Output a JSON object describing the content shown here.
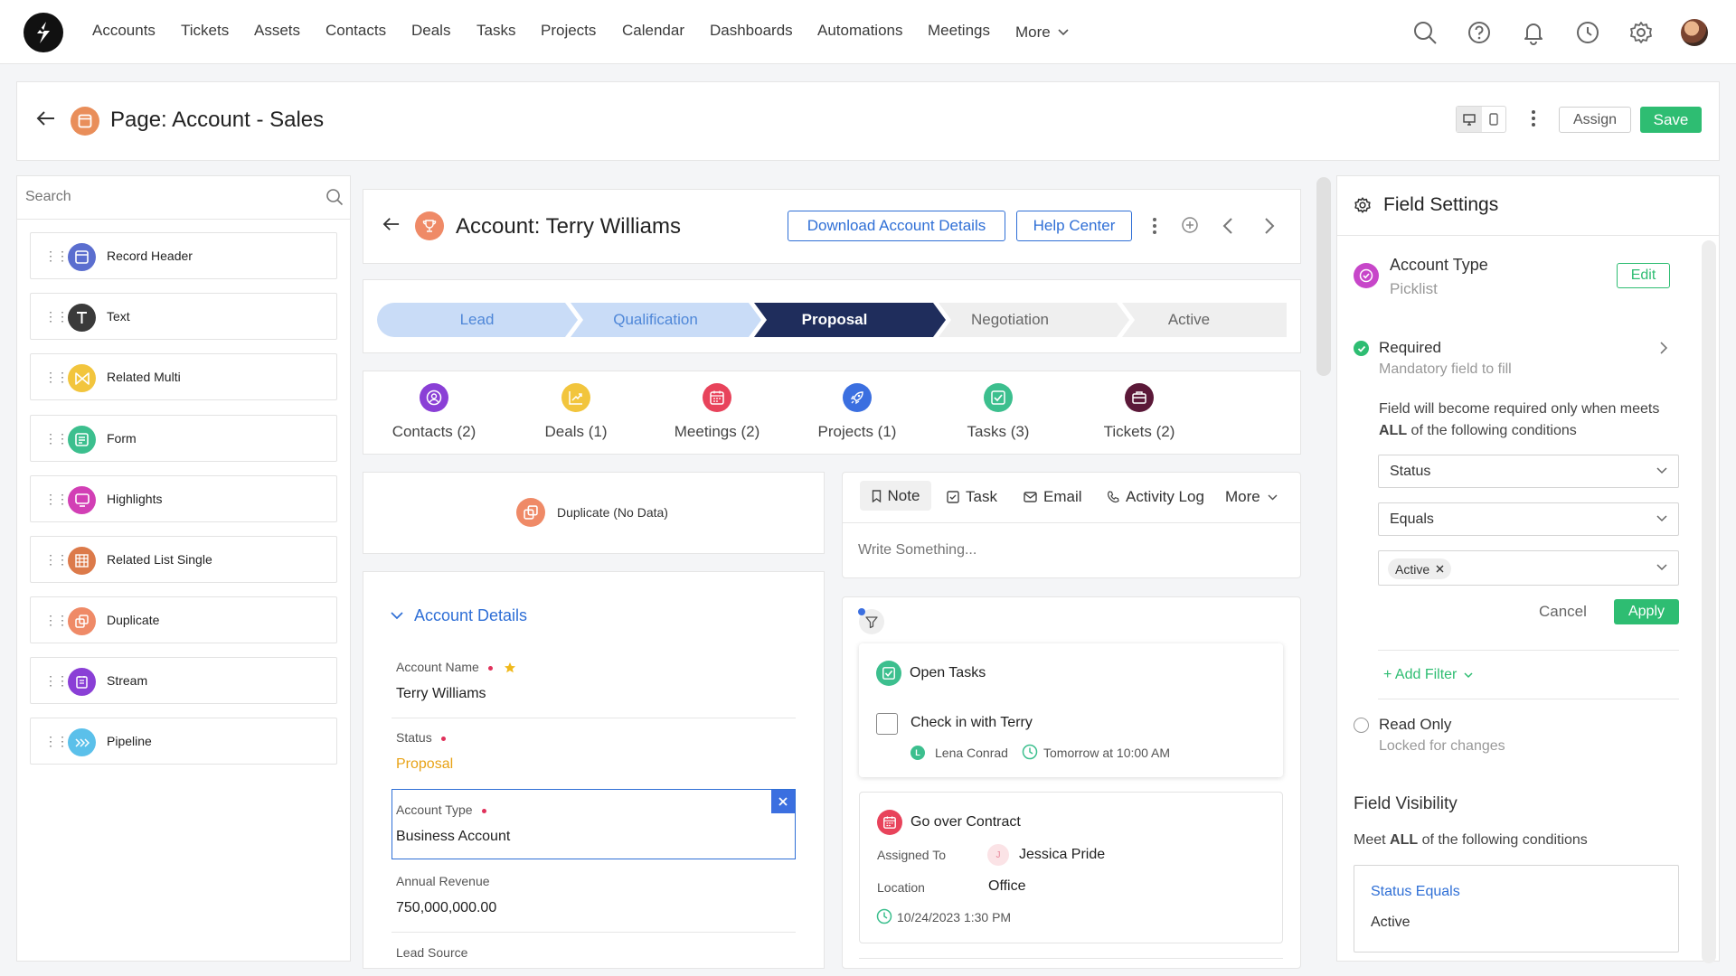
{
  "nav": {
    "items": [
      "Accounts",
      "Tickets",
      "Assets",
      "Contacts",
      "Deals",
      "Tasks",
      "Projects",
      "Calendar",
      "Dashboards",
      "Automations",
      "Meetings"
    ],
    "more_label": "More"
  },
  "header": {
    "title": "Page: Account - Sales",
    "assign_label": "Assign",
    "save_label": "Save"
  },
  "components": {
    "search_placeholder": "Search",
    "items": [
      "Record Header",
      "Text",
      "Related Multi",
      "Form",
      "Highlights",
      "Related List Single",
      "Duplicate",
      "Stream",
      "Pipeline"
    ]
  },
  "record": {
    "title": "Account: Terry Williams",
    "download_label": "Download Account Details",
    "help_label": "Help Center"
  },
  "pipeline": {
    "stages": [
      "Lead",
      "Qualification",
      "Proposal",
      "Negotiation",
      "Active"
    ],
    "current": "Proposal"
  },
  "related": {
    "items": [
      "Contacts (2)",
      "Deals (1)",
      "Meetings (2)",
      "Projects (1)",
      "Tasks (3)",
      "Tickets (2)"
    ]
  },
  "duplicate": {
    "label": "Duplicate (No Data)"
  },
  "details": {
    "section_title": "Account Details",
    "fields": [
      {
        "label": "Account Name",
        "value": "Terry Williams"
      },
      {
        "label": "Status",
        "value": "Proposal"
      },
      {
        "label": "Account Type",
        "value": "Business Account"
      },
      {
        "label": "Annual Revenue",
        "value": "750,000,000.00"
      },
      {
        "label": "Lead Source",
        "value": ""
      }
    ]
  },
  "activity": {
    "tabs": [
      "Note",
      "Task",
      "Email",
      "Activity Log"
    ],
    "more_label": "More",
    "placeholder": "Write Something...",
    "open_tasks": {
      "title": "Open Tasks",
      "task": "Check in with Terry",
      "assignee_initial": "L",
      "assignee": "Lena Conrad",
      "due": "Tomorrow at 10:00 AM"
    },
    "meeting": {
      "title": "Go over Contract",
      "assigned_label": "Assigned To",
      "assigned_initial": "J",
      "assigned_value": "Jessica Pride",
      "location_label": "Location",
      "location_value": "Office",
      "datetime": "10/24/2023 1:30 PM"
    }
  },
  "field_settings": {
    "title": "Field Settings",
    "field_name": "Account Type",
    "field_type": "Picklist",
    "edit_label": "Edit",
    "required": {
      "title": "Required",
      "subtitle": "Mandatory field to fill",
      "desc_prefix": "Field will become required only when meets ",
      "desc_bold": "ALL",
      "desc_suffix": " of the following conditions"
    },
    "condition": {
      "field": "Status",
      "operator": "Equals",
      "value_chip": "Active"
    },
    "cancel_label": "Cancel",
    "apply_label": "Apply",
    "add_filter_label": "+ Add Filter",
    "read_only": {
      "title": "Read Only",
      "subtitle": "Locked for changes"
    },
    "visibility": {
      "title": "Field Visibility",
      "desc_prefix": "Meet ",
      "desc_bold": "ALL",
      "desc_suffix": " of the following conditions",
      "rule_title": "Status Equals",
      "rule_value": "Active"
    }
  },
  "colors": {
    "accent_blue": "#2f6fd6",
    "pipeline_active": "#1f2d5c",
    "pipeline_done": "#c9dcf7",
    "save_green": "#2ebd72",
    "required_red": "#e0315b"
  }
}
